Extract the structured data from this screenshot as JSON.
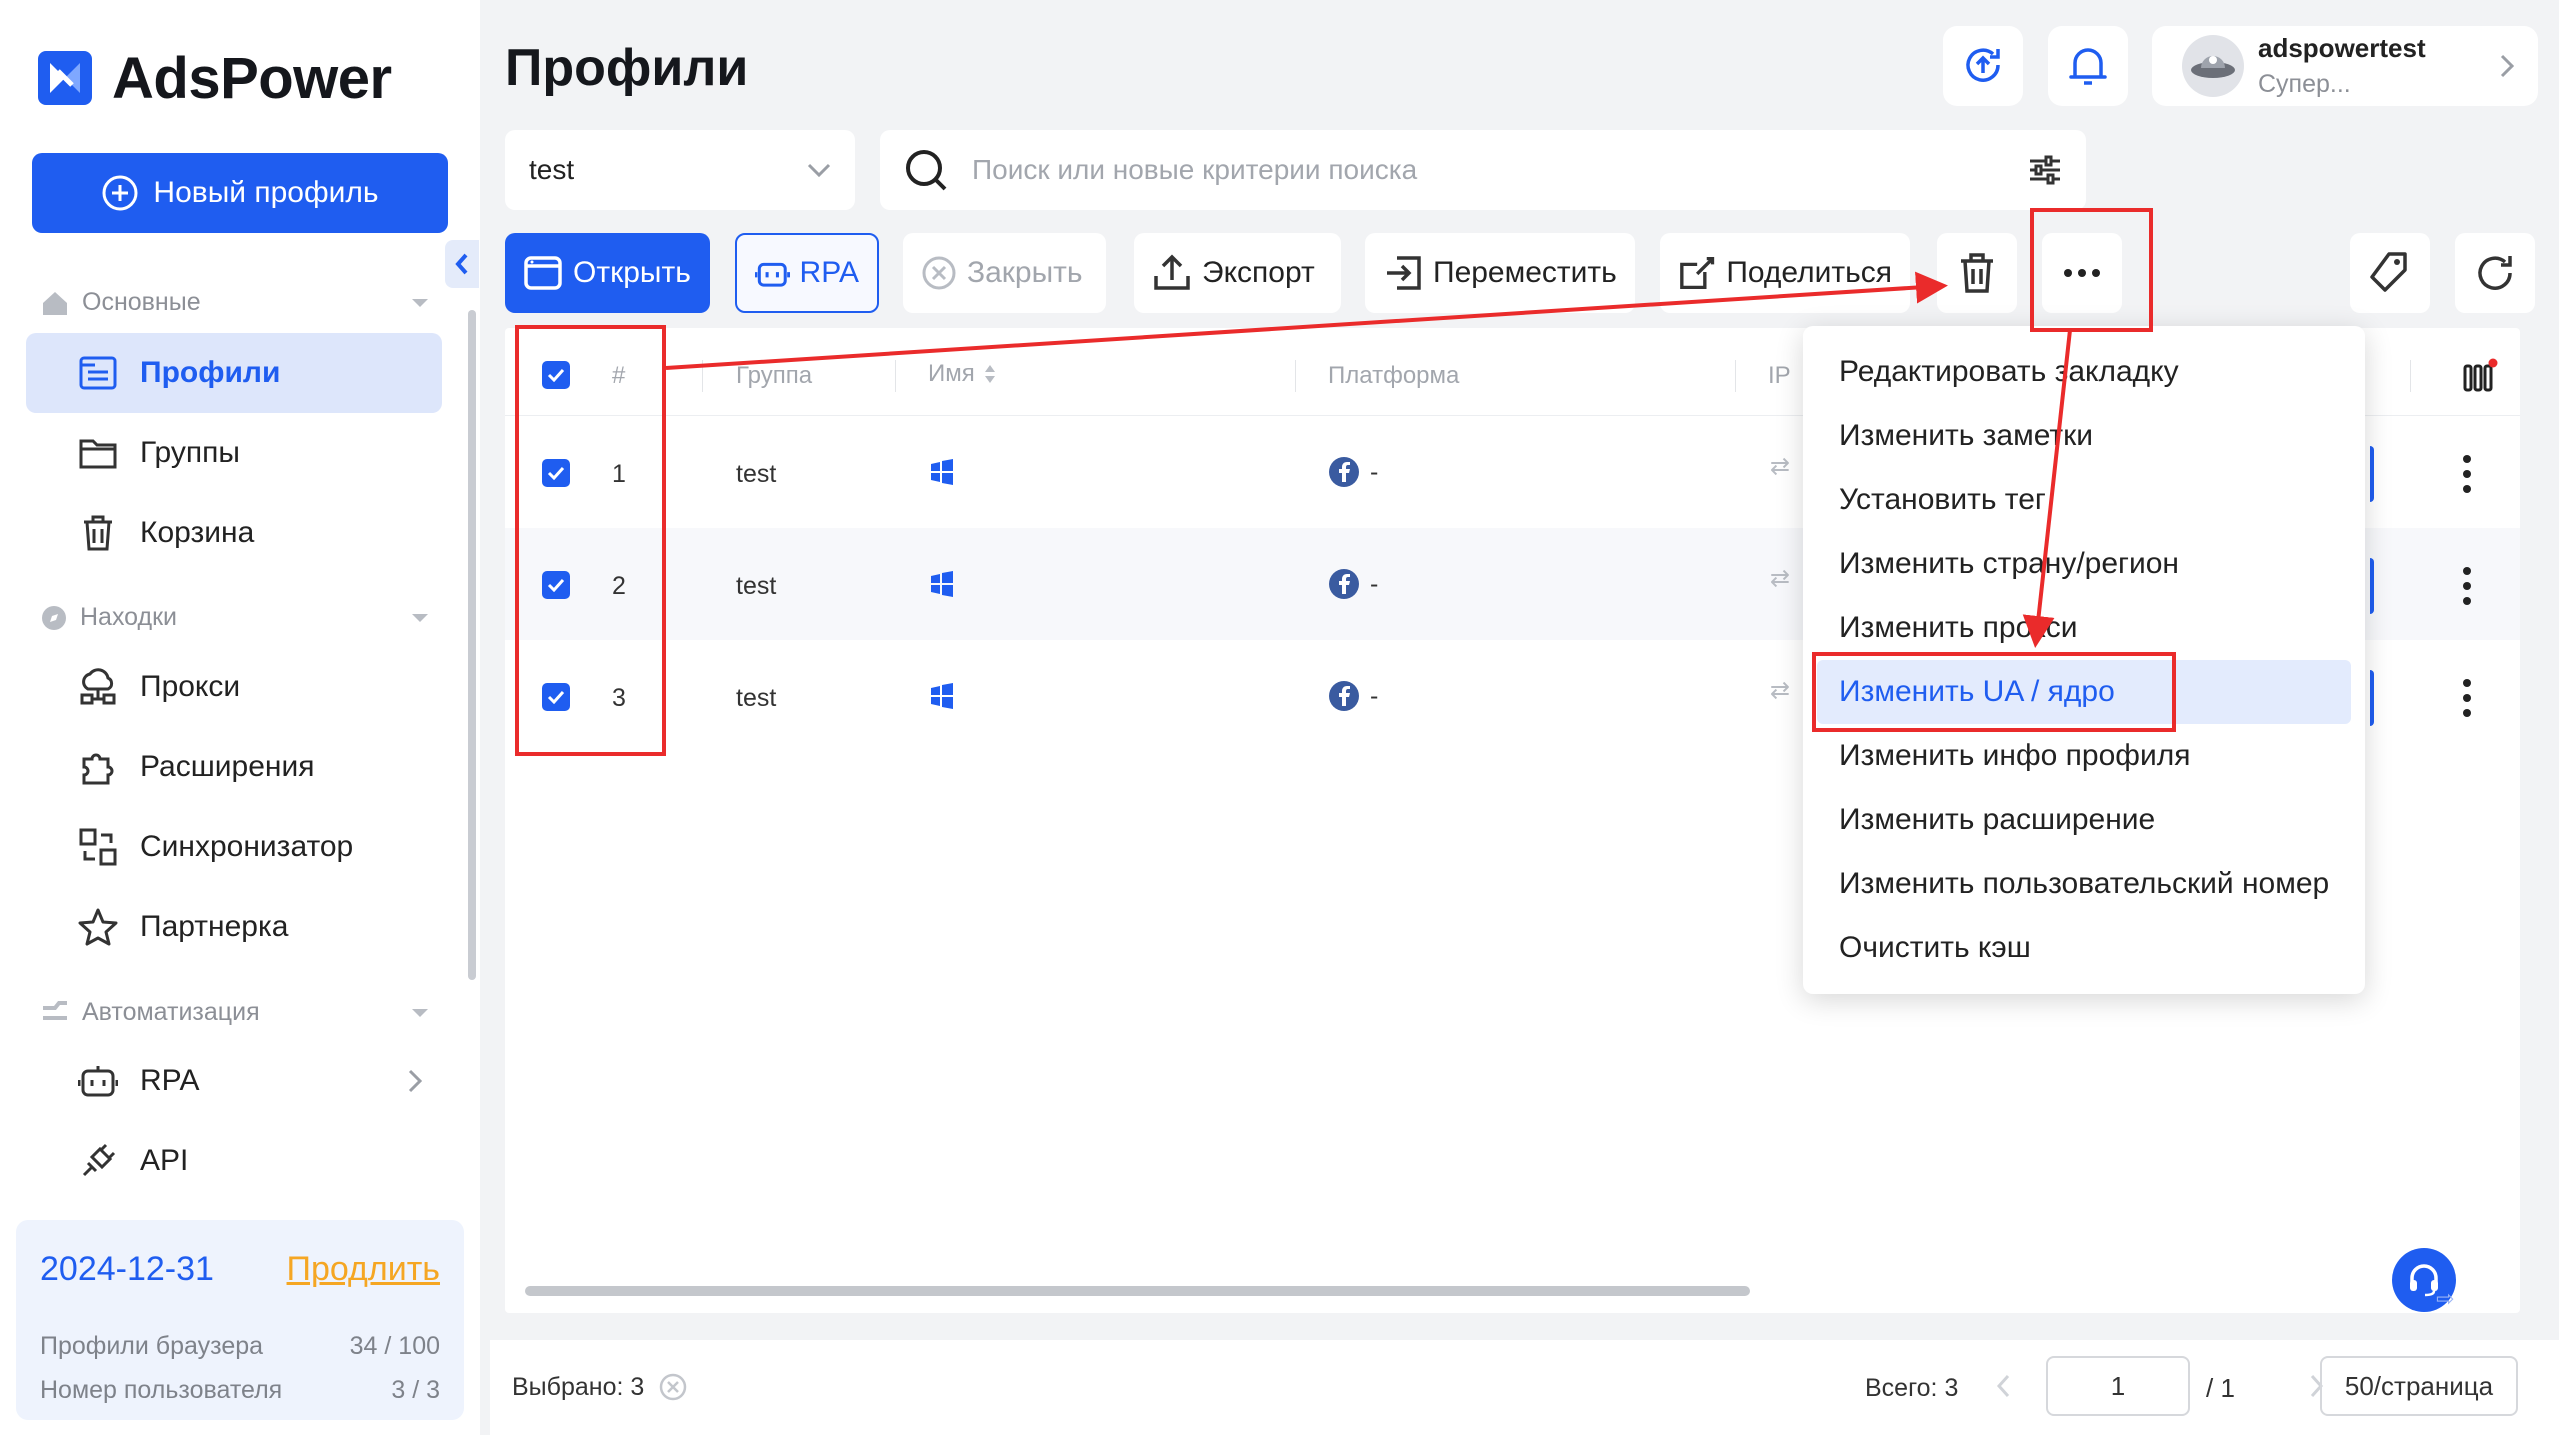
{
  "app": {
    "name": "AdsPower",
    "page_title": "Профили"
  },
  "sidebar": {
    "new_profile": "Новый профиль",
    "sections": [
      {
        "title": "Основные",
        "items": [
          {
            "label": "Профили",
            "active": true
          },
          {
            "label": "Группы"
          },
          {
            "label": "Корзина"
          }
        ]
      },
      {
        "title": "Находки",
        "items": [
          {
            "label": "Прокси"
          },
          {
            "label": "Расширения"
          },
          {
            "label": "Синхронизатор"
          },
          {
            "label": "Партнерка"
          }
        ]
      },
      {
        "title": "Автоматизация",
        "items": [
          {
            "label": "RPA"
          },
          {
            "label": "API"
          }
        ]
      }
    ],
    "plan": {
      "expiry": "2024-12-31",
      "renew": "Продлить",
      "browser_profiles_label": "Профили браузера",
      "browser_profiles_value": "34 / 100",
      "user_number_label": "Номер пользователя",
      "user_number_value": "3 / 3"
    }
  },
  "header": {
    "username": "adspowertest",
    "role": "Супер..."
  },
  "filters": {
    "group": "test",
    "search_placeholder": "Поиск или новые критерии поиска"
  },
  "toolbar": {
    "open": "Открыть",
    "rpa": "RPA",
    "close": "Закрыть",
    "export": "Экспорт",
    "move": "Переместить",
    "share": "Поделиться"
  },
  "table": {
    "headers": {
      "num": "#",
      "group": "Группа",
      "name": "Имя",
      "platform": "Платформа",
      "ip": "IP"
    },
    "rows": [
      {
        "num": "1",
        "group": "test",
        "platform": "-"
      },
      {
        "num": "2",
        "group": "test",
        "platform": "-"
      },
      {
        "num": "3",
        "group": "test",
        "platform": "-"
      }
    ]
  },
  "menu": {
    "items": [
      "Редактировать закладку",
      "Изменить заметки",
      "Установить тег",
      "Изменить страну/регион",
      "Изменить прокси",
      "Изменить UA / ядро",
      "Изменить инфо профиля",
      "Изменить расширение",
      "Изменить пользовательский номер",
      "Очистить кэш"
    ],
    "highlighted": "Изменить UA / ядро"
  },
  "footer": {
    "selected": "Выбрано: 3",
    "total": "Всего: 3",
    "page": "1",
    "pages": "/ 1",
    "per_page": "50/страница"
  },
  "colors": {
    "primary": "#1f5df0",
    "annotation": "#ea2b2b",
    "accent_orange": "#f5a623"
  }
}
